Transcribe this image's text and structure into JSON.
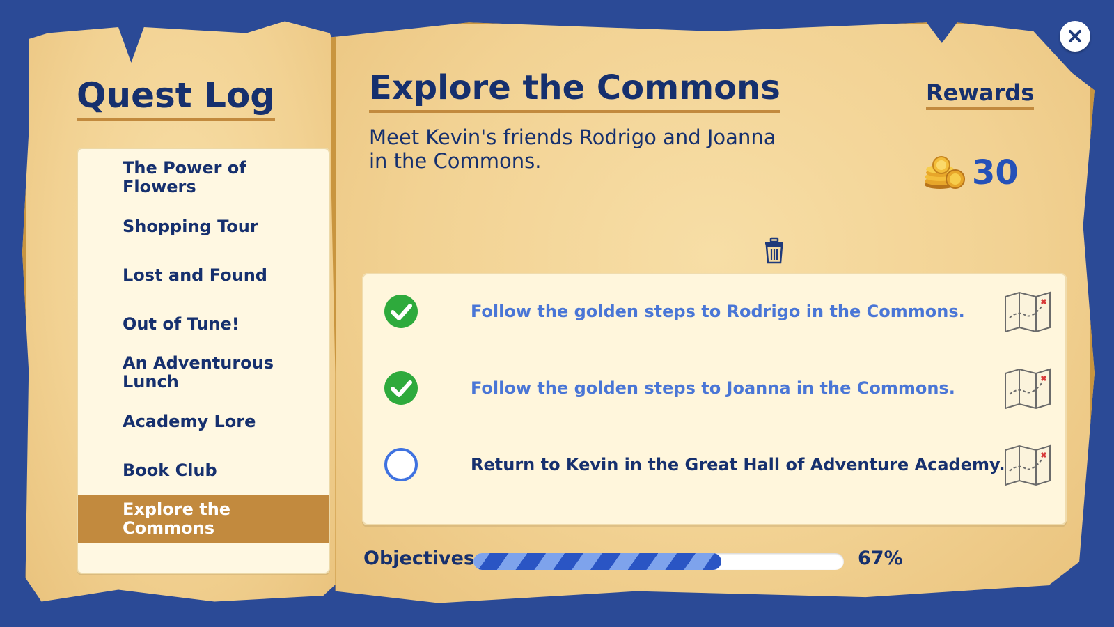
{
  "quest_log": {
    "title": "Quest Log",
    "quests": [
      {
        "label": "The Power of Flowers",
        "selected": false
      },
      {
        "label": "Shopping Tour",
        "selected": false
      },
      {
        "label": "Lost and Found",
        "selected": false
      },
      {
        "label": "Out of Tune!",
        "selected": false
      },
      {
        "label": "An Adventurous Lunch",
        "selected": false
      },
      {
        "label": "Academy Lore",
        "selected": false
      },
      {
        "label": "Book Club",
        "selected": false
      },
      {
        "label": "Explore the Commons",
        "selected": true
      }
    ]
  },
  "quest": {
    "title": "Explore the Commons",
    "description": "Meet Kevin's friends Rodrigo and Joanna in the Commons."
  },
  "rewards": {
    "title": "Rewards",
    "coins": "30",
    "icon": "coin-stack-icon"
  },
  "objectives": {
    "items": [
      {
        "text": "Follow the golden steps to Rodrigo in the Commons.",
        "completed": true
      },
      {
        "text": "Follow the golden steps to Joanna in the Commons.",
        "completed": true
      },
      {
        "text": "Return to Kevin in the Great Hall of Adventure Academy.",
        "completed": false
      }
    ],
    "label": "Objectives",
    "progress_text": "67%",
    "progress": 0.67
  },
  "colors": {
    "background": "#2b4a96",
    "parchment": "#f2d293",
    "accent": "#c28a3e",
    "text": "#16306e",
    "completed_text": "#4a76d6",
    "check_green": "#2eaa3c"
  }
}
